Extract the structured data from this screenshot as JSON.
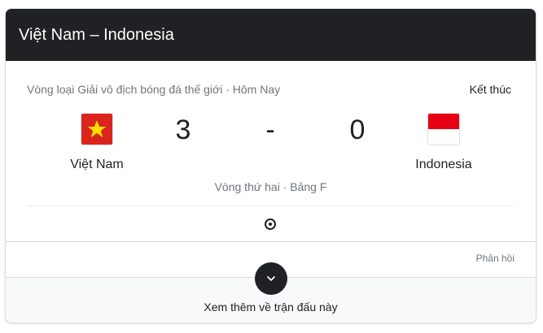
{
  "header": {
    "title": "Việt Nam – Indonesia"
  },
  "match": {
    "competition": "Vòng loại Giải vô địch bóng đá thế giới · Hôm Nay",
    "status": "Kết thúc",
    "home": {
      "name": "Việt Nam",
      "score": "3",
      "flag_icon": "vietnam-flag-icon"
    },
    "away": {
      "name": "Indonesia",
      "score": "0",
      "flag_icon": "indonesia-flag-icon"
    },
    "separator": "-",
    "round": "Vòng thứ hai · Bảng F"
  },
  "feedback_label": "Phản hồi",
  "footer": {
    "label": "Xem thêm về trận đấu này",
    "expand_icon": "chevron-down-icon"
  },
  "colors": {
    "header_bg": "#202124",
    "vn_red": "#da251d",
    "vn_star": "#ffde00",
    "id_red": "#e70011"
  }
}
